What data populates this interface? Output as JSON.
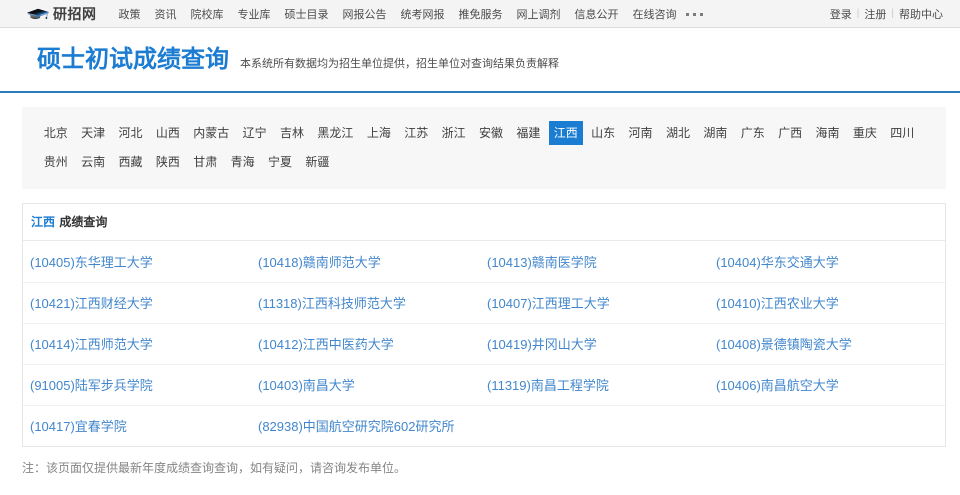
{
  "topbar": {
    "logo_text": "研招网",
    "logo_icon": "graduation-cap-icon",
    "menu": [
      "政策",
      "资讯",
      "院校库",
      "专业库",
      "硕士目录",
      "网报公告",
      "统考网报",
      "推免服务",
      "网上调剂",
      "信息公开",
      "在线咨询"
    ],
    "more_label": "•••",
    "user_links": [
      "登录",
      "注册",
      "帮助中心"
    ],
    "link_separator": "|"
  },
  "header": {
    "title": "硕士初试成绩查询",
    "subtitle": "本系统所有数据均为招生单位提供，招生单位对查询结果负责解释"
  },
  "provinces": {
    "active": "江西",
    "rows": [
      [
        "北京",
        "天津",
        "河北",
        "山西",
        "内蒙古",
        "辽宁",
        "吉林",
        "黑龙江",
        "上海",
        "江苏",
        "浙江",
        "安徽",
        "福建",
        "江西",
        "山东",
        "河南",
        "湖北",
        "湖南",
        "广东",
        "广西",
        "海南",
        "重庆",
        "四川"
      ],
      [
        "贵州",
        "云南",
        "西藏",
        "陕西",
        "甘肃",
        "青海",
        "宁夏",
        "新疆"
      ]
    ]
  },
  "panel": {
    "province": "江西",
    "title": "成绩查询",
    "rows": [
      [
        "(10405)东华理工大学",
        "(10418)赣南师范大学",
        "(10413)赣南医学院",
        "(10404)华东交通大学"
      ],
      [
        "(10421)江西财经大学",
        "(11318)江西科技师范大学",
        "(10407)江西理工大学",
        "(10410)江西农业大学"
      ],
      [
        "(10414)江西师范大学",
        "(10412)江西中医药大学",
        "(10419)井冈山大学",
        "(10408)景德镇陶瓷大学"
      ],
      [
        "(91005)陆军步兵学院",
        "(10403)南昌大学",
        "(11319)南昌工程学院",
        "(10406)南昌航空大学"
      ],
      [
        "(10417)宜春学院",
        "(82938)中国航空研究院602研究所"
      ]
    ]
  },
  "note": "注：该页面仅提供最新年度成绩查询查询，如有疑问，请咨询发布单位。",
  "colors": {
    "accent_blue": "#1b7cd2",
    "active_tab_bg": "#1b7dd2",
    "link_blue": "#4287cc",
    "header_border": "#2c7dc0",
    "topbar_bg": "#f4f4f5",
    "province_box_bg": "#f7f7f8"
  }
}
